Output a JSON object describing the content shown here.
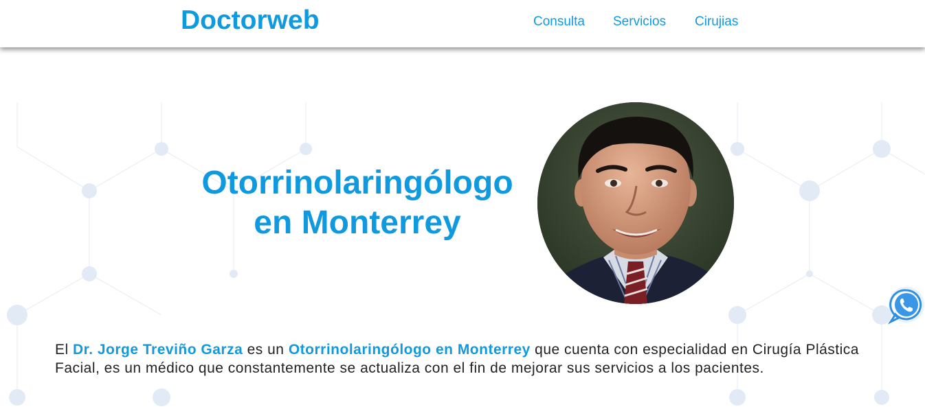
{
  "header": {
    "logo": "Doctorweb",
    "nav": [
      {
        "label": "Consulta"
      },
      {
        "label": "Servicios"
      },
      {
        "label": "Cirujias"
      }
    ]
  },
  "hero": {
    "title_line1": "Otorrinolaringólogo",
    "title_line2": "en Monterrey"
  },
  "intro": {
    "t1": "El ",
    "doctor_name": "Dr. Jorge Treviño Garza",
    "t2": " es un ",
    "specialty": "Otorrinolaringólogo en Monterrey",
    "t3": " que cuenta con especialidad en Cirugía Plástica Facial, es un médico que constantemente se actualiza con el fin de mejorar sus servicios a los pacientes."
  },
  "colors": {
    "brand_blue": "#0f9ae0",
    "body_text": "#222222",
    "pattern": "#dfe8f5"
  },
  "icons": {
    "whatsapp": "whatsapp-icon"
  }
}
